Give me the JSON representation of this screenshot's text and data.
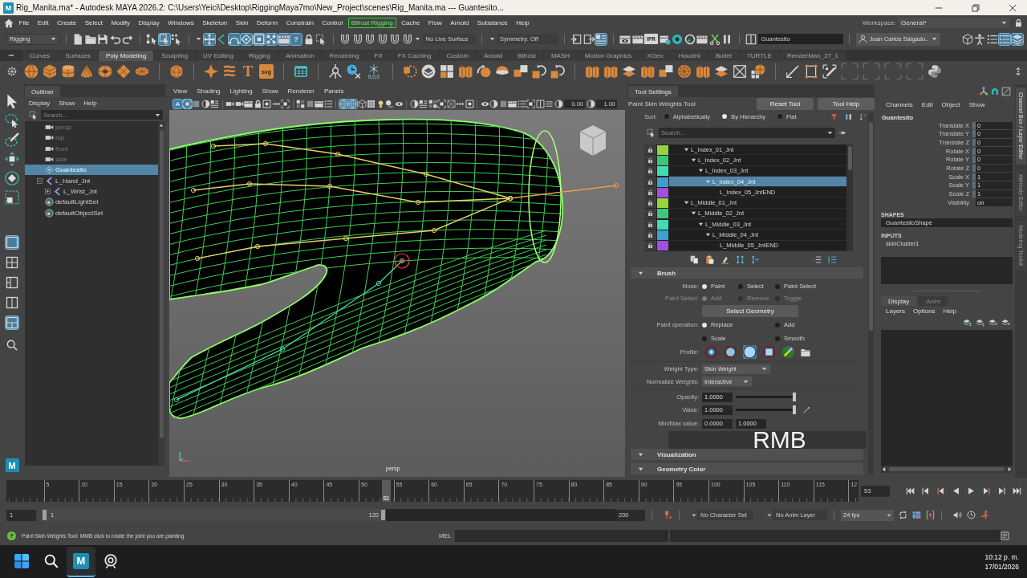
{
  "title_bar": {
    "app_icon": "M",
    "title": "Rig_Manita.ma* - Autodesk MAYA 2026.2: C:\\Users\\Yeici\\Desktop\\RiggingMaya7mo\\New_Project\\scenes\\Rig_Manita.ma --- Guantesito..."
  },
  "menu_bar": {
    "items": [
      {
        "label": "File",
        "highlighted": false
      },
      {
        "label": "Edit",
        "highlighted": false
      },
      {
        "label": "Create",
        "highlighted": false
      },
      {
        "label": "Select",
        "highlighted": false
      },
      {
        "label": "Modify",
        "highlighted": false
      },
      {
        "label": "Display",
        "highlighted": false
      },
      {
        "label": "Windows",
        "highlighted": false
      },
      {
        "label": "Skeleton",
        "highlighted": false
      },
      {
        "label": "Skin",
        "highlighted": false
      },
      {
        "label": "Deform",
        "highlighted": false
      },
      {
        "label": "Constrain",
        "highlighted": false
      },
      {
        "label": "Control",
        "highlighted": false
      },
      {
        "label": "Bifrost Rigging",
        "highlighted": true
      },
      {
        "label": "Cache",
        "highlighted": false
      },
      {
        "label": "Flow",
        "highlighted": false
      },
      {
        "label": "Arnold",
        "highlighted": false
      },
      {
        "label": "Substance",
        "highlighted": false
      },
      {
        "label": "Help",
        "highlighted": false
      }
    ],
    "workspace": {
      "label": "Workspace:",
      "value": "General*"
    }
  },
  "status_line": {
    "mode": "Rigging",
    "select_modes": [
      {
        "selected": false
      },
      {
        "selected": true
      },
      {
        "selected": false
      }
    ],
    "snap_toggles": [
      {
        "on": true
      },
      {
        "on": false
      },
      {
        "on": true
      },
      {
        "on": true
      },
      {
        "on": true
      },
      {
        "on": true
      },
      {
        "on": true
      },
      {
        "on": true,
        "label": "?"
      }
    ],
    "live_surface": "No Live Surface",
    "symmetry": "Symmetry: Off",
    "panel_toggles": [
      {
        "on": false
      },
      {
        "on": false
      },
      {
        "on": true
      }
    ],
    "ipr_label": "IPR",
    "object_name": "Guantesito",
    "user": "Juan Carlos Salgado..",
    "layout_toggles": [
      {
        "on": false
      },
      {
        "on": false
      },
      {
        "on": false
      },
      {
        "on": true
      },
      {
        "on": true
      }
    ]
  },
  "shelf": {
    "tabs": [
      {
        "label": "Curves",
        "selected": false
      },
      {
        "label": "Surfaces",
        "selected": false
      },
      {
        "label": "Poly Modeling",
        "selected": true
      },
      {
        "label": "Sculpting",
        "selected": false
      },
      {
        "label": "UV Editing",
        "selected": false
      },
      {
        "label": "Rigging",
        "selected": false
      },
      {
        "label": "Animation",
        "selected": false
      },
      {
        "label": "Rendering",
        "selected": false
      },
      {
        "label": "FX",
        "selected": false
      },
      {
        "label": "FX Caching",
        "selected": false
      },
      {
        "label": "Custom",
        "selected": false
      },
      {
        "label": "Arnold",
        "selected": false
      },
      {
        "label": "Bifrost",
        "selected": false
      },
      {
        "label": "MASH",
        "selected": false
      },
      {
        "label": "Motion Graphics",
        "selected": false
      },
      {
        "label": "XGen",
        "selected": false
      },
      {
        "label": "Houdini",
        "selected": false
      },
      {
        "label": "Bullet",
        "selected": false
      },
      {
        "label": "TURTLE",
        "selected": false
      },
      {
        "label": "RenderMan_27_1",
        "selected": false
      }
    ],
    "text_icon": "T",
    "svg_icon": "svg",
    "reset_icon": "0,0,0"
  },
  "toolbox": {
    "tools": [
      {
        "selected": false
      },
      {
        "selected": false
      },
      {
        "selected": false
      },
      {
        "selected": false
      },
      {
        "selected": false
      },
      {
        "selected": false
      }
    ],
    "layouts": [
      {
        "selected": true
      },
      {
        "selected": false
      },
      {
        "selected": false
      },
      {
        "selected": false
      },
      {
        "selected": true
      }
    ],
    "logo": "M"
  },
  "outliner": {
    "tab": "Outliner",
    "menus": [
      "Display",
      "Show",
      "Help"
    ],
    "search": {
      "placeholder": "Search..."
    },
    "items": [
      {
        "name": "persp",
        "kind": "camera",
        "hidden": true,
        "selected": false
      },
      {
        "name": "top",
        "kind": "camera",
        "hidden": true,
        "selected": false
      },
      {
        "name": "front",
        "kind": "camera",
        "hidden": true,
        "selected": false
      },
      {
        "name": "side",
        "kind": "camera",
        "hidden": true,
        "selected": false
      },
      {
        "name": "Guantesito",
        "kind": "mesh",
        "hidden": false,
        "selected": true
      },
      {
        "name": "L_Hand_Jnt",
        "kind": "joint",
        "hidden": false,
        "selected": false,
        "expanded": true,
        "children": [
          {
            "name": "L_Wrist_Jnt",
            "kind": "joint",
            "hidden": false,
            "selected": false,
            "expanded": false
          }
        ]
      },
      {
        "name": "defaultLightSet",
        "kind": "set",
        "hidden": false,
        "selected": false
      },
      {
        "name": "defaultObjectSet",
        "kind": "set",
        "hidden": false,
        "selected": false
      }
    ]
  },
  "viewport": {
    "menus": [
      "View",
      "Shading",
      "Lighting",
      "Show",
      "Renderer",
      "Panels"
    ],
    "toolbar": [
      {
        "on": true,
        "label": "A"
      },
      {
        "on": true
      },
      {
        "on": false
      },
      {
        "on": false
      },
      {
        "on": false
      },
      {
        "on": false
      },
      {
        "on": false
      },
      {
        "on": false
      },
      {
        "on": false
      },
      {
        "on": false
      },
      {
        "on": false
      },
      {
        "on": false
      },
      {
        "on": false
      },
      {
        "on": false
      },
      {
        "on": false
      },
      {
        "on": false
      },
      {
        "on": true
      },
      {
        "on": true
      },
      {
        "on": false
      },
      {
        "on": false
      },
      {
        "on": false
      },
      {
        "on": false
      },
      {
        "on": false
      },
      {
        "on": false
      },
      {
        "on": false
      },
      {
        "on": false
      },
      {
        "on": false
      },
      {
        "on": false
      },
      {
        "on": false
      },
      {
        "on": false
      },
      {
        "on": false
      },
      {
        "on": false
      },
      {
        "on": false
      },
      {
        "on": false
      },
      {
        "on": false
      },
      {
        "on": false
      },
      {
        "on": false
      },
      {
        "on": false
      }
    ],
    "exposure": "0.00",
    "gamma": "1.00",
    "camera": "persp"
  },
  "tool_settings": {
    "tab": "Tool Settings",
    "title": "Paint Skin Weights Tool",
    "buttons": [
      {
        "label": "Reset Tool"
      },
      {
        "label": "Tool Help"
      }
    ],
    "sort": {
      "label": "Sort:",
      "options": [
        {
          "label": "Alphabetically",
          "selected": false
        },
        {
          "label": "By Hierarchy",
          "selected": true
        },
        {
          "label": "Flat",
          "selected": false
        }
      ]
    },
    "search": {
      "placeholder": "Search..."
    },
    "influences": [
      {
        "name": "L_Index_01_Jnt",
        "color": "#96d43c",
        "selected": false,
        "expanded": true,
        "children": [
          {
            "name": "L_Index_02_Jnt",
            "color": "#3cc878",
            "selected": false,
            "expanded": true,
            "children": [
              {
                "name": "L_Index_03_Jnt",
                "color": "#40dcb4",
                "selected": false,
                "expanded": true,
                "children": [
                  {
                    "name": "L_Index_04_Jnt",
                    "color": "#3ca0d2",
                    "selected": true,
                    "expanded": true,
                    "children": [
                      {
                        "name": "L_Index_05_JntEND",
                        "color": "#a050dc",
                        "selected": false
                      }
                    ]
                  }
                ]
              }
            ]
          }
        ]
      },
      {
        "name": "L_Middle_01_Jnt",
        "color": "#96d43c",
        "selected": false,
        "expanded": true,
        "children": [
          {
            "name": "L_Middle_02_Jnt",
            "color": "#3cc878",
            "selected": false,
            "expanded": true,
            "children": [
              {
                "name": "L_Middle_03_Jnt",
                "color": "#40dcb4",
                "selected": false,
                "expanded": true,
                "children": [
                  {
                    "name": "L_Middle_04_Jnt",
                    "color": "#3ca0d2",
                    "selected": false,
                    "expanded": true,
                    "children": [
                      {
                        "name": "L_Middle_05_JntEND",
                        "color": "#a050dc",
                        "selected": false
                      }
                    ]
                  }
                ]
              }
            ]
          }
        ]
      }
    ],
    "brush": {
      "title": "Brush",
      "expanded": true,
      "mode": {
        "label": "Mode:",
        "options": [
          {
            "label": "Paint",
            "selected": true
          },
          {
            "label": "Select",
            "selected": false
          },
          {
            "label": "Paint Select",
            "selected": false
          }
        ]
      },
      "paint_select": {
        "label": "Paint Select:",
        "disabled": true,
        "options": [
          {
            "label": "Add",
            "selected": true
          },
          {
            "label": "Remove",
            "selected": false
          },
          {
            "label": "Toggle",
            "selected": false
          }
        ]
      },
      "select_geometry": "Select Geometry",
      "paint_operation": {
        "label": "Paint operation:",
        "options": [
          {
            "label": "Replace",
            "selected": true
          },
          {
            "label": "Add",
            "selected": false
          },
          {
            "label": "Scale",
            "selected": false
          },
          {
            "label": "Smooth",
            "selected": false
          }
        ]
      },
      "profile": {
        "label": "Profile:",
        "options": [
          {
            "kind": "gaussian",
            "selected": false
          },
          {
            "kind": "soft",
            "selected": false
          },
          {
            "kind": "solid",
            "selected": true
          },
          {
            "kind": "square",
            "selected": false
          },
          {
            "kind": "image",
            "selected": false
          }
        ]
      },
      "weight_type": {
        "label": "Weight Type:",
        "value": "Skin Weight"
      },
      "normalize": {
        "label": "Normalize Weights:",
        "value": "Interactive"
      },
      "opacity": {
        "label": "Opacity:",
        "value": "1.0000",
        "level": 1
      },
      "value": {
        "label": "Value:",
        "value": "1.0000",
        "level": 1
      },
      "min_max": {
        "label": "Min/Max value:",
        "min": "0.0000",
        "max": "1.0000"
      }
    },
    "sections": [
      {
        "title": "Visualization",
        "expanded": true
      },
      {
        "title": "Geometry Color",
        "expanded": true
      }
    ]
  },
  "key_overlay": {
    "text": "RMB"
  },
  "channel_box": {
    "menus": [
      "Channels",
      "Edit",
      "Object",
      "Show"
    ],
    "object": "Guantesito",
    "channels": [
      {
        "label": "Translate X",
        "value": "0",
        "kind": "number"
      },
      {
        "label": "Translate Y",
        "value": "0",
        "kind": "number"
      },
      {
        "label": "Translate Z",
        "value": "0",
        "kind": "number"
      },
      {
        "label": "Rotate X",
        "value": "0",
        "kind": "number"
      },
      {
        "label": "Rotate Y",
        "value": "0",
        "kind": "number"
      },
      {
        "label": "Rotate Z",
        "value": "0",
        "kind": "number"
      },
      {
        "label": "Scale X",
        "value": "1",
        "kind": "number"
      },
      {
        "label": "Scale Y",
        "value": "1",
        "kind": "number"
      },
      {
        "label": "Scale Z",
        "value": "1",
        "kind": "number"
      },
      {
        "label": "Visibility",
        "value": "on",
        "kind": "boolean"
      }
    ],
    "shapes": {
      "title": "SHAPES",
      "items": [
        "GuantesitoShape"
      ]
    },
    "inputs": {
      "title": "INPUTS",
      "items": [
        "skinCluster1"
      ]
    },
    "layer_tabs": [
      {
        "label": "Display",
        "selected": true
      },
      {
        "label": "Anim",
        "selected": false
      }
    ],
    "layer_menus": [
      "Layers",
      "Options",
      "Help"
    ]
  },
  "side_tabs": [
    {
      "label": "Channel Box / Layer Editor",
      "selected": true
    },
    {
      "label": "Attribute Editor",
      "selected": false
    },
    {
      "label": "Modeling Toolkit",
      "selected": false
    }
  ],
  "timeline": {
    "ticks": [
      "5",
      "10",
      "15",
      "20",
      "25",
      "30",
      "35",
      "40",
      "45",
      "50",
      "55",
      "60",
      "65",
      "70",
      "75",
      "80",
      "85",
      "90",
      "95",
      "100",
      "105",
      "110",
      "115",
      "12"
    ],
    "playhead": {
      "label": "53",
      "level": 0.445
    },
    "current_frame": "53"
  },
  "range": {
    "start": "1",
    "range_start": "1",
    "range_end": "120",
    "level": 0.6,
    "end": "200",
    "character_set": "No Character Set",
    "anim_layer": "No Anim Layer",
    "fps": "24 fps"
  },
  "help_line": {
    "icon": "?",
    "text": "Paint Skin Weights Tool: MMB click to rotate the joint you are painting.",
    "command_language": "MEL"
  },
  "taskbar": {
    "apps": [
      {
        "kind": "start",
        "selected": false
      },
      {
        "kind": "search",
        "selected": false
      },
      {
        "kind": "maya",
        "selected": true,
        "label": "M"
      },
      {
        "kind": "app",
        "selected": false
      }
    ],
    "time": "10:12 p. m.",
    "date": "17/01/2026"
  }
}
